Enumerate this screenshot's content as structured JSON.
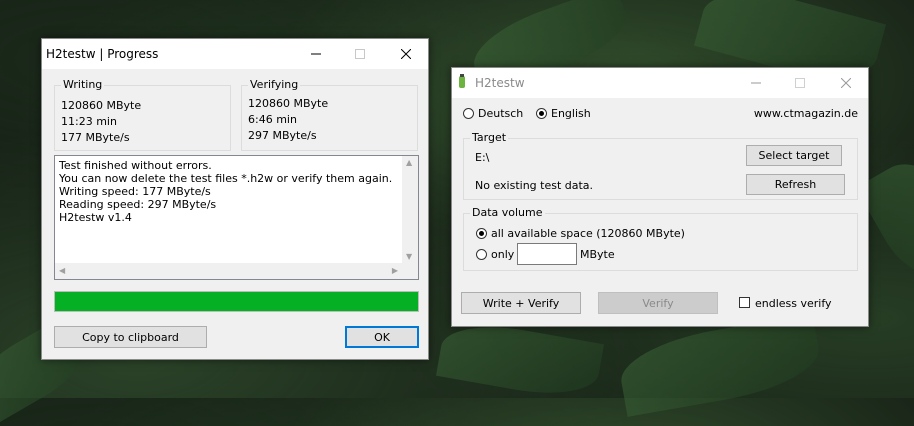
{
  "progress_window": {
    "title": "H2testw | Progress",
    "writing": {
      "label": "Writing",
      "size": "120860 MByte",
      "time": "11:23 min",
      "speed": "177 MByte/s"
    },
    "verifying": {
      "label": "Verifying",
      "size": "120860 MByte",
      "time": "6:46 min",
      "speed": "297 MByte/s"
    },
    "log_lines": [
      "Test finished without errors.",
      "You can now delete the test files *.h2w or verify them again.",
      "Writing speed: 177 MByte/s",
      "Reading speed: 297 MByte/s",
      "H2testw v1.4"
    ],
    "progress_fraction": 1.0,
    "progress_color": "#06b025",
    "copy_label": "Copy to clipboard",
    "ok_label": "OK"
  },
  "main_window": {
    "title": "H2testw",
    "languages": [
      {
        "label": "Deutsch",
        "selected": false
      },
      {
        "label": "English",
        "selected": true
      }
    ],
    "website": "www.ctmagazin.de",
    "target": {
      "group_label": "Target",
      "path": "E:\\",
      "status": "No existing test data.",
      "select_label": "Select target",
      "refresh_label": "Refresh"
    },
    "data_volume": {
      "group_label": "Data volume",
      "all_label": "all available space (120860 MByte)",
      "all_selected": true,
      "only_label": "only",
      "only_value": "",
      "unit_label": "MByte"
    },
    "write_verify_label": "Write + Verify",
    "verify_label": "Verify",
    "endless_label": "endless verify",
    "endless_checked": false
  }
}
